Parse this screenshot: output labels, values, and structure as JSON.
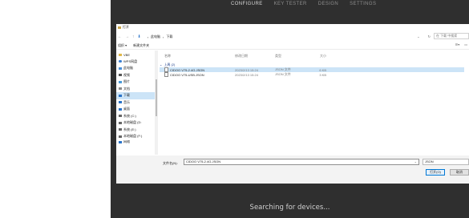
{
  "topnav": [
    "CONFIGURE",
    "KEY TESTER",
    "DESIGN",
    "SETTINGS"
  ],
  "status": "Searching for devices...",
  "colors": {
    "app_bg": "#2f2f2f",
    "accent": "#0078d4",
    "selection": "#cce4f7"
  },
  "dialog": {
    "title": "打开",
    "nav_icons": [
      "back-arrow",
      "forward-arrow",
      "up-arrow",
      "download-icon"
    ],
    "breadcrumb": [
      "此电脑",
      "下载"
    ],
    "search_placeholder": "在 下载 中搜索",
    "toolbar": {
      "organize": "组织 ▾",
      "new_folder": "新建文件夹"
    },
    "sidebar": [
      {
        "label": "VBE",
        "icon": "folder-icon"
      },
      {
        "label": "WPS网盘",
        "icon": "cloud-icon"
      },
      {
        "label": "此电脑",
        "icon": "computer-icon"
      },
      {
        "label": "视频",
        "icon": "video-icon"
      },
      {
        "label": "图片",
        "icon": "picture-icon"
      },
      {
        "label": "文档",
        "icon": "document-icon"
      },
      {
        "label": "下载",
        "icon": "download-icon",
        "selected": true
      },
      {
        "label": "音乐",
        "icon": "music-icon"
      },
      {
        "label": "桌面",
        "icon": "desktop-icon"
      },
      {
        "label": "系统 (C:)",
        "icon": "drive-icon"
      },
      {
        "label": "本地磁盘 (D:",
        "icon": "drive-icon"
      },
      {
        "label": "系统 (E:)",
        "icon": "drive-icon"
      },
      {
        "label": "本地磁盘 (F:)",
        "icon": "drive-icon"
      },
      {
        "label": "网络",
        "icon": "network-icon"
      }
    ],
    "columns": {
      "name": "名称",
      "date": "修改日期",
      "type": "类型",
      "size": "大小"
    },
    "group_label": "上周 (2)",
    "files": [
      {
        "name": "CIDOO V75-2.4G.JSON",
        "date": "2023/2/13 15:24",
        "type": "JSON 文件",
        "size": "6 KB",
        "selected": true
      },
      {
        "name": "CIDOO V75-USB.JSON",
        "date": "2023/2/13 15:24",
        "type": "JSON 文件",
        "size": "3 KB",
        "selected": false
      }
    ],
    "filename_label": "文件名(N):",
    "filename_value": "CIDOO V75-2.4G.JSON",
    "filetype": "JSON",
    "open_button": "打开(O)",
    "cancel_button": "取消"
  }
}
